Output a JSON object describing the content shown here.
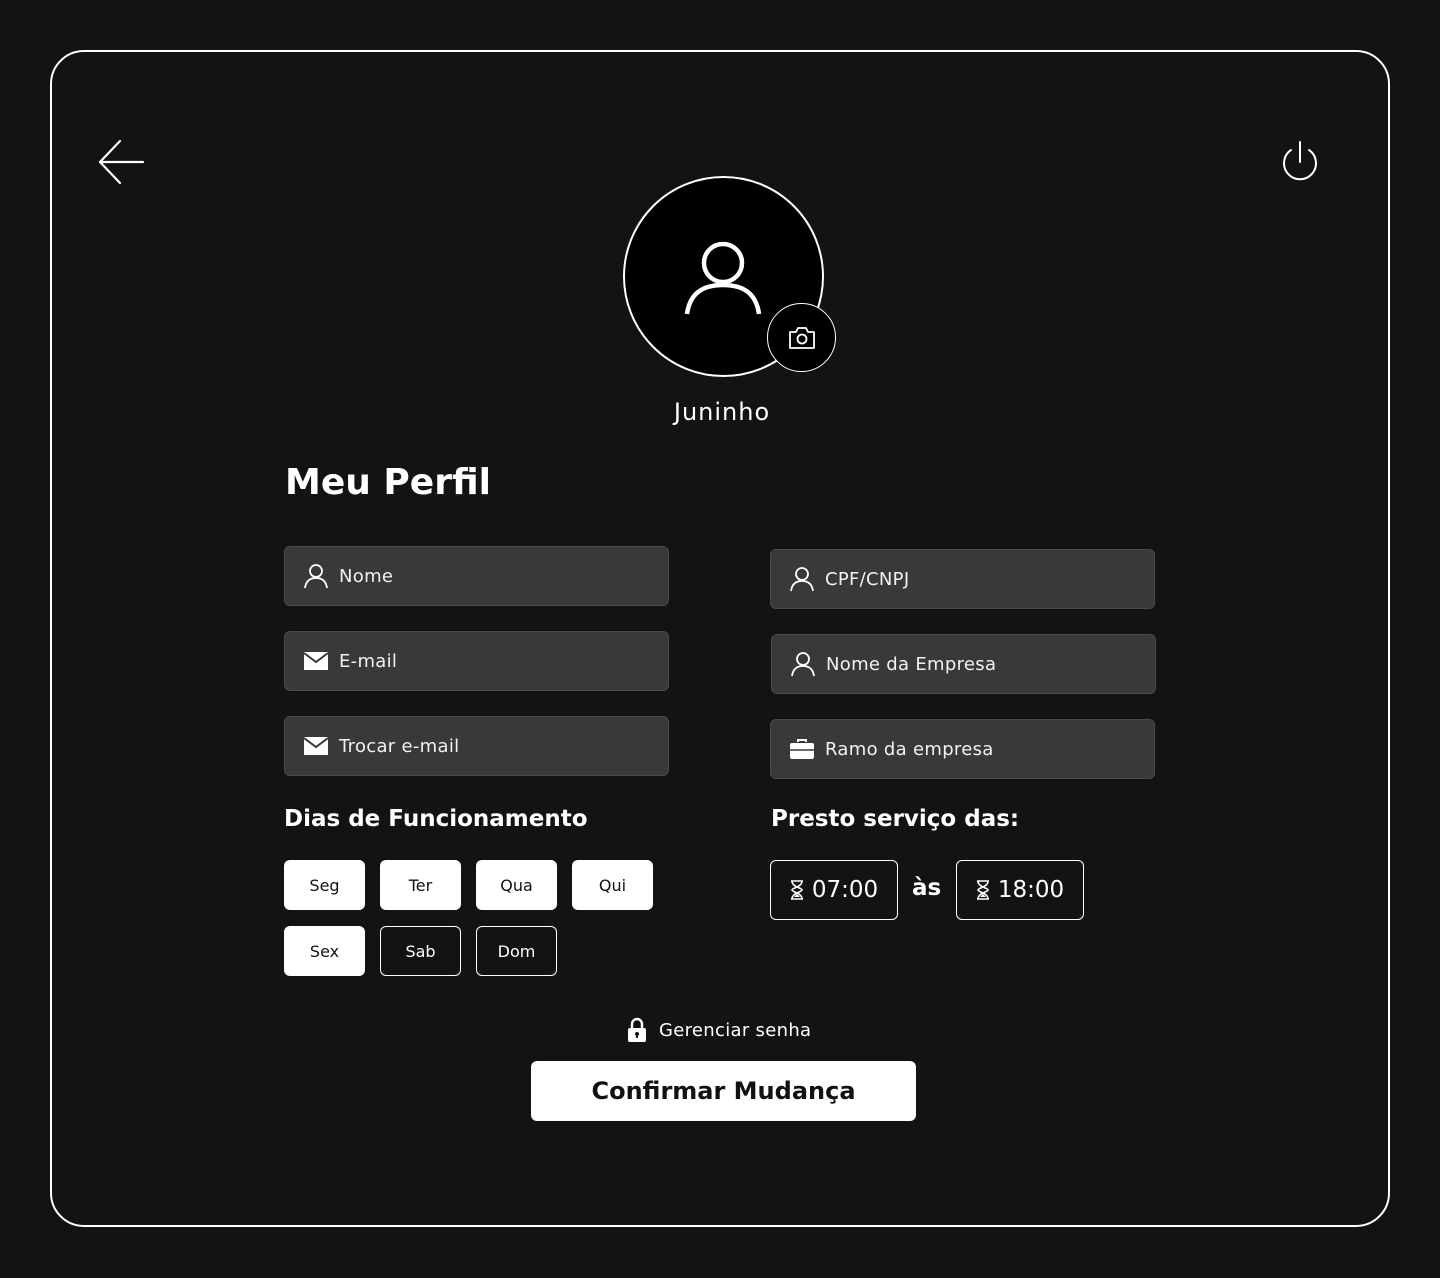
{
  "profile": {
    "username": "Juninho",
    "title": "Meu Perfil"
  },
  "fields": {
    "nome": "Nome",
    "email": "E-mail",
    "trocar_email": "Trocar e-mail",
    "cpf_cnpj": "CPF/CNPJ",
    "nome_empresa": "Nome da Empresa",
    "ramo_empresa": "Ramo da empresa"
  },
  "days_section": {
    "label": "Dias de Funcionamento",
    "days": [
      {
        "label": "Seg",
        "selected": true
      },
      {
        "label": "Ter",
        "selected": true
      },
      {
        "label": "Qua",
        "selected": true
      },
      {
        "label": "Qui",
        "selected": true
      },
      {
        "label": "Sex",
        "selected": true
      },
      {
        "label": "Sab",
        "selected": false
      },
      {
        "label": "Dom",
        "selected": false
      }
    ]
  },
  "hours_section": {
    "label": "Presto serviço das:",
    "start": "07:00",
    "separator": "às",
    "end": "18:00"
  },
  "password_link": "Gerenciar senha",
  "confirm_label": "Confirmar Mudança",
  "colors": {
    "background": "#141213",
    "field": "#393939",
    "accent": "#ffffff"
  }
}
